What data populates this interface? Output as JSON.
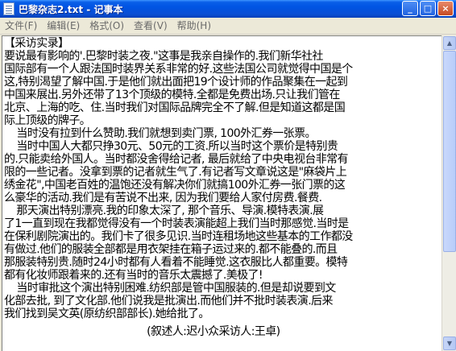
{
  "window": {
    "title": "巴黎杂志2.txt - 记事本",
    "minimize_glyph": "_",
    "maximize_glyph": "□",
    "close_glyph": "×"
  },
  "menu": [
    {
      "label": "文件(F)"
    },
    {
      "label": "编辑(E)"
    },
    {
      "label": "格式(O)"
    },
    {
      "label": "查看(V)"
    },
    {
      "label": "帮助(H)"
    }
  ],
  "document": {
    "lines": [
      "【采访实录】",
      "要说最有影响的'.巴黎时装之夜.\"这事是我亲自操作的.我们新华社社",
      "国际部有一个人跟法国时装界关系非常的好.这些法国公司就觉得中国是个",
      "这,特别渴望了解中国.于是他们就出面把19个设计师的作品聚集在一起到",
      "中国来展出.另外还带了13个顶级的模特.全都是免费出场.只让我们管在",
      "北京、上海的吃、住.当时我们对国际品牌完全不了解.但是知道这都是国",
      "际上顶级的牌子。",
      "    当时没有拉到什么赞助.我们就想到卖门票, 100外汇券一张票。",
      "    当时中国人大都只挣30元、50元的工资.所以当时这个票价是特别贵",
      "的.只能卖给外国人。当时都没舍得给记者, 最后就给了中央电视台非常有",
      "限的一些记者。没拿到票的记者就生气了.有记者写文章说这是\"麻袋片上",
      "绣金花\",中国老百姓的温饱还没有解决你们就搞100外汇券一张门票的这",
      "么豪华的活动.我们是有苦说不出来, 因为我们要给人家付房费.餐费.",
      "    那天演出特别漂亮.我的印象太深了, 那个音乐、导演.模特表演.展",
      "了1一直到现在我都觉得没有一个时装表演能超上我们当时那感觉.当时是",
      "在保利剧院演出的。我们卡了很多见识.当时连租场地这些基本的工作都没",
      "有做过.他们的服装全部都是用衣架挂在箱子运过来的.都不能叠的.而且",
      "那服装特别贵.随时24小时都有人看着不能睡觉.这衣服比人都重要。模特",
      "都有化妆师跟着来的.还有当时的音乐太震撼了.美极了!",
      "    当时审批这个演出特别困难.纺织部是管中国服装的.但是却说要到文",
      "化部去批, 到了文化部.他们说我是批演出.而他们并不批时装表演.后来",
      "我们找到吴文英(原纺织部部长).她给批了。",
      "                                              (叙述人:迟小众采访人:王卓)"
    ]
  },
  "scrollbar": {
    "up_glyph": "▲",
    "down_glyph": "▼"
  }
}
